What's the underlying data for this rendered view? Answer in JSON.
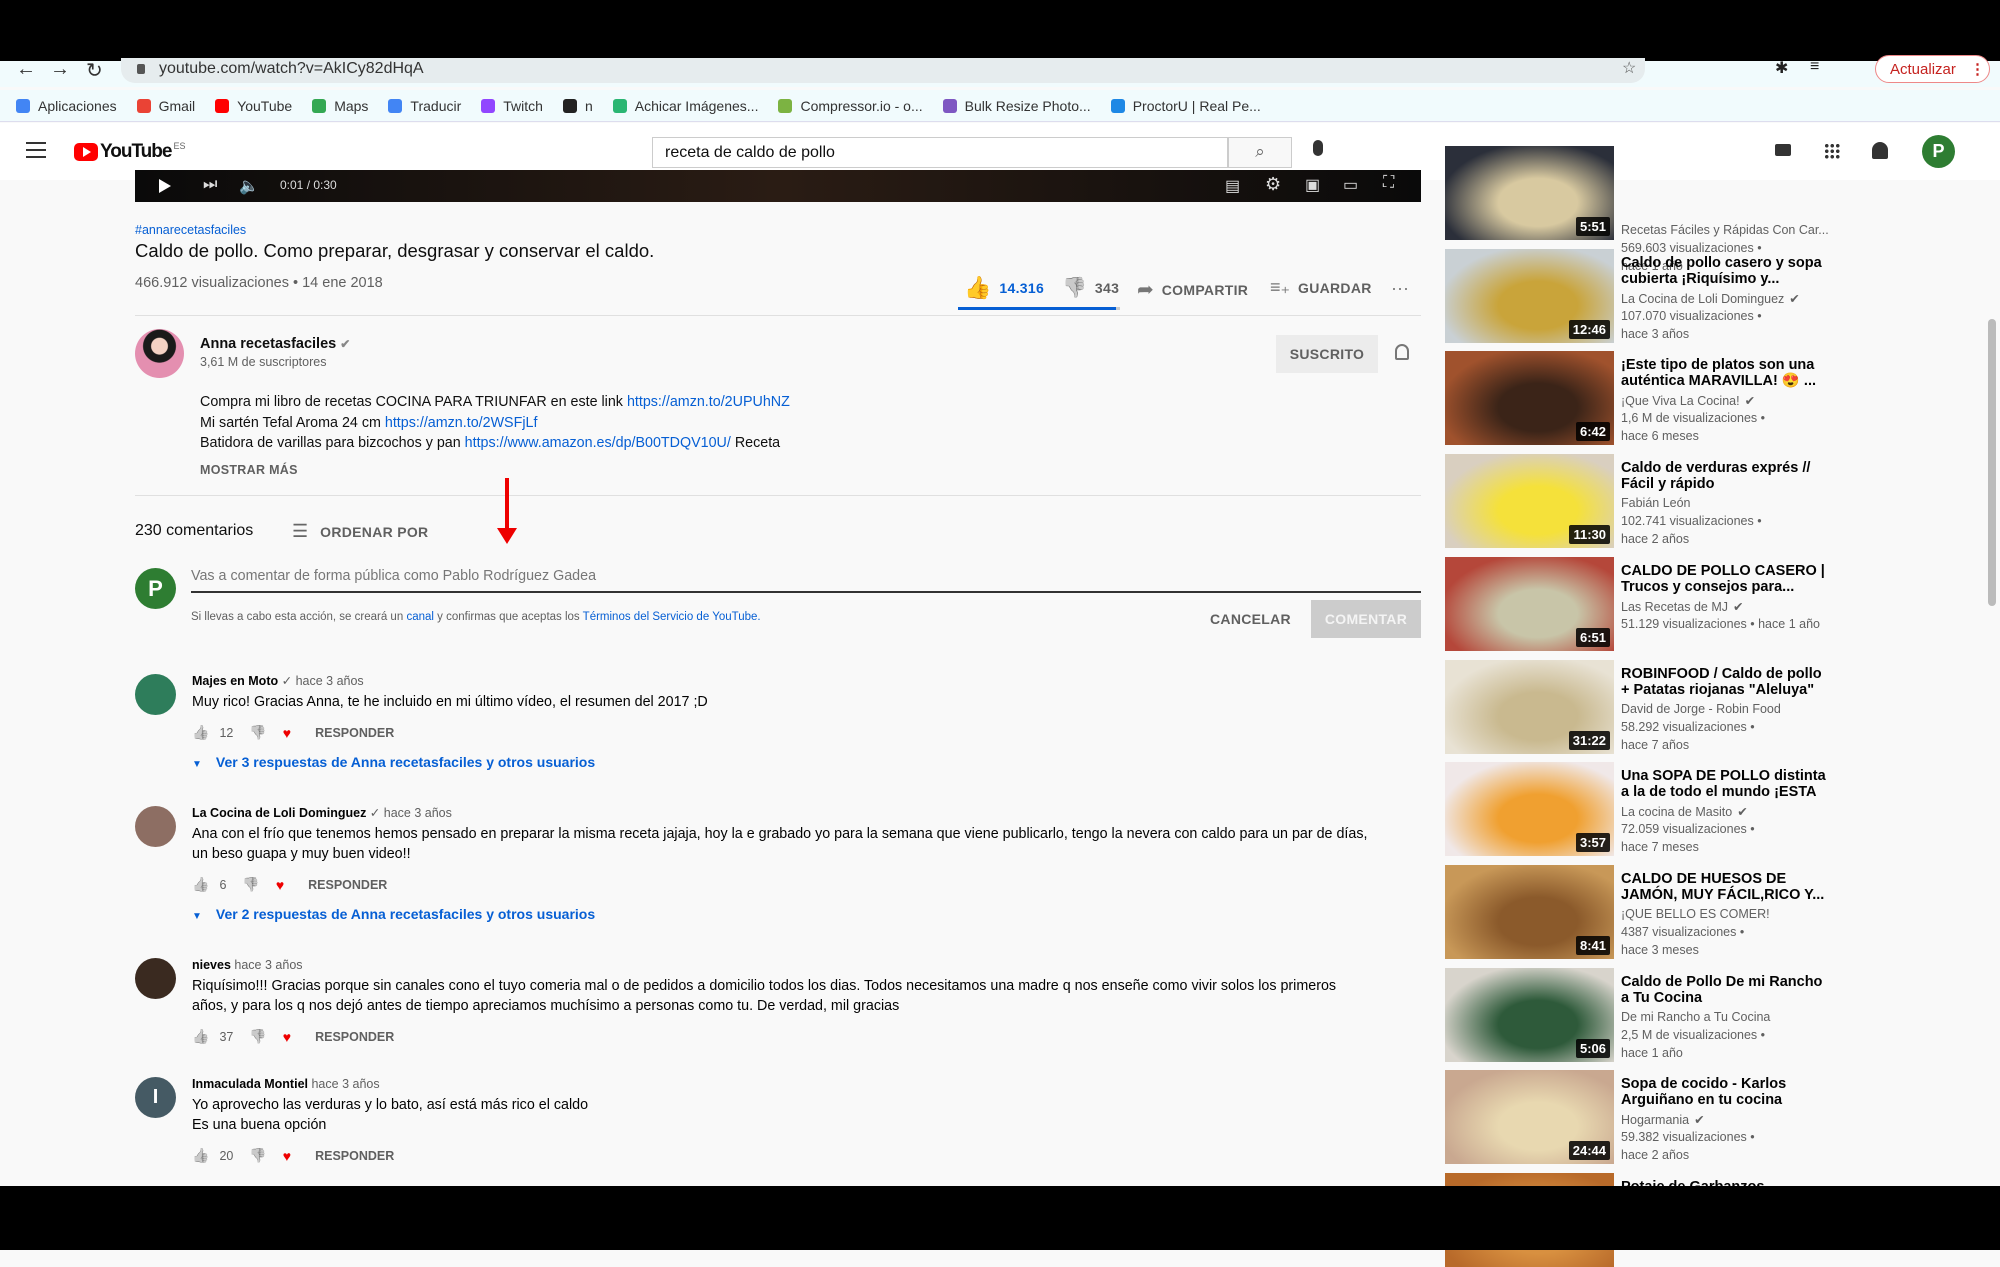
{
  "browser": {
    "url": "youtube.com/watch?v=AkICy82dHqA",
    "update_label": "Actualizar",
    "bookmarks": [
      {
        "label": "Aplicaciones",
        "color": "#4285f4"
      },
      {
        "label": "Gmail",
        "color": "#ea4335"
      },
      {
        "label": "YouTube",
        "color": "#ff0000"
      },
      {
        "label": "Maps",
        "color": "#34a853"
      },
      {
        "label": "Traducir",
        "color": "#4285f4"
      },
      {
        "label": "Twitch",
        "color": "#9146ff"
      },
      {
        "label": "n",
        "color": "#222"
      },
      {
        "label": "Achicar Imágenes...",
        "color": "#2bb673"
      },
      {
        "label": "Compressor.io - o...",
        "color": "#7cb342"
      },
      {
        "label": "Bulk Resize Photo...",
        "color": "#7e57c2"
      },
      {
        "label": "ProctorU | Real Pe...",
        "color": "#1e88e5"
      }
    ]
  },
  "header": {
    "logo": "YouTube",
    "region": "ES",
    "search_value": "receta de caldo de pollo",
    "avatar_letter": "P",
    "accent": "#ff0000"
  },
  "player": {
    "time": "0:01 / 0:30"
  },
  "video": {
    "hashtag": "#annarecetasfaciles",
    "title": "Caldo de pollo. Como preparar, desgrasar y conservar el caldo.",
    "views_date": "466.912 visualizaciones • 14 ene 2018",
    "likes": "14.316",
    "dislikes": "343",
    "share": "COMPARTIR",
    "save": "GUARDAR",
    "like_fraction": 0.977
  },
  "channel": {
    "name": "Anna recetasfaciles",
    "subs": "3,61 M de suscriptores",
    "subscribed": "SUSCRITO",
    "desc": [
      {
        "text": "Compra mi libro de recetas COCINA PARA TRIUNFAR en este link ",
        "link": "https://amzn.to/2UPUhNZ",
        "after": ""
      },
      {
        "text": "Mi sartén Tefal Aroma 24 cm ",
        "link": "https://amzn.to/2WSFjLf",
        "after": ""
      },
      {
        "text": "Batidora de varillas para bizcochos y pan  ",
        "link": "https://www.amazon.es/dp/B00TDQV10U/",
        "after": " Receta"
      }
    ],
    "show_more": "MOSTRAR MÁS"
  },
  "comments_header": {
    "count": "230 comentarios",
    "sort": "ORDENAR POR"
  },
  "composer": {
    "placeholder": "Vas a comentar de forma pública como Pablo Rodríguez Gadea",
    "notice_pre": "Si llevas a cabo esta acción, se creará un ",
    "notice_link1": "canal",
    "notice_mid": " y confirmas que aceptas los ",
    "notice_link2": "Términos del Servicio de YouTube.",
    "cancel": "CANCELAR",
    "submit": "COMENTAR",
    "avatar_letter": "P"
  },
  "reply_label": "RESPONDER",
  "comments": [
    {
      "author": "Majes en Moto",
      "verified": true,
      "age": "hace 3 años",
      "text": [
        "Muy rico! Gracias Anna, te he incluido en mi último vídeo, el resumen del 2017 ;D"
      ],
      "likes": "12",
      "replies": "Ver 3 respuestas de Anna recetasfaciles y otros usuarios",
      "avatar_color": "#2e7d5b",
      "avatar_letter": ""
    },
    {
      "author": "La Cocina de Loli Dominguez",
      "verified": true,
      "age": "hace 3 años",
      "text": [
        "Ana con el frío que tenemos hemos pensado en  preparar la misma receta jajaja, hoy la e grabado yo para la semana que viene publicarlo,  tengo la nevera con caldo para un par de días,",
        "un beso guapa y muy buen video!!"
      ],
      "likes": "6",
      "replies": "Ver 2 respuestas de Anna recetasfaciles y otros usuarios",
      "avatar_color": "#8d6e63",
      "avatar_letter": ""
    },
    {
      "author": "nieves",
      "verified": false,
      "age": "hace 3 años",
      "text": [
        "Riquísimo!!! Gracias porque sin canales cono el tuyo comeria mal o de pedidos a domicilio todos los dias. Todos necesitamos una madre q nos enseñe como vivir solos los primeros",
        "años, y para los q nos dejó antes de tiempo apreciamos muchísimo a personas como tu. De verdad, mil gracias"
      ],
      "likes": "37",
      "replies": "",
      "avatar_color": "#3a2a20",
      "avatar_letter": ""
    },
    {
      "author": "Inmaculada Montiel",
      "verified": false,
      "age": "hace 3 años",
      "text": [
        "Yo aprovecho las verduras y lo bato, así está más rico el caldo",
        "Es una buena opción"
      ],
      "likes": "20",
      "replies": "",
      "avatar_color": "#455a64",
      "avatar_letter": "I"
    }
  ],
  "sidebar": [
    {
      "title": "",
      "channel": "Recetas Fáciles y Rápidas Con Car...",
      "verified": false,
      "views": "569.603 visualizaciones",
      "age": "hace 1 año",
      "duration": "5:51",
      "colors": [
        "#2b2f3a",
        "#d8c9a0"
      ]
    },
    {
      "title": "Caldo de pollo casero y sopa cubierta ¡Riquísimo y...",
      "channel": "La Cocina de Loli Dominguez",
      "verified": true,
      "views": "107.070 visualizaciones",
      "age": "hace 3 años",
      "duration": "12:46",
      "colors": [
        "#c9d0d4",
        "#c9a43a"
      ]
    },
    {
      "title": "¡Este tipo de platos son una auténtica MARAVILLA! 😍 ...",
      "channel": "¡Que Viva La Cocina!",
      "verified": true,
      "views": "1,6 M de visualizaciones",
      "age": "hace 6 meses",
      "duration": "6:42",
      "colors": [
        "#a0522d",
        "#3b2418"
      ]
    },
    {
      "title": "Caldo de verduras exprés // Fácil y rápido",
      "channel": "Fabián León",
      "verified": false,
      "views": "102.741 visualizaciones",
      "age": "hace 2 años",
      "duration": "11:30",
      "colors": [
        "#d9cfc0",
        "#f5e13a"
      ]
    },
    {
      "title": "CALDO DE POLLO CASERO | Trucos y consejos para...",
      "channel": "Las Recetas de MJ",
      "verified": true,
      "views": "51.129 visualizaciones",
      "age": "hace 1 año",
      "inline_meta": true,
      "duration": "6:51",
      "colors": [
        "#b5473a",
        "#c8c5a8"
      ]
    },
    {
      "title": "ROBINFOOD / Caldo de pollo + Patatas riojanas \"Aleluya\"",
      "channel": "David de Jorge - Robin Food",
      "verified": false,
      "views": "58.292 visualizaciones",
      "age": "hace 7 años",
      "duration": "31:22",
      "colors": [
        "#e8e2d4",
        "#c9b98f"
      ]
    },
    {
      "title": "Una SOPA DE POLLO distinta a la de todo el mundo ¡ESTA DE...",
      "channel": "La cocina de Masito",
      "verified": true,
      "views": "72.059 visualizaciones",
      "age": "hace 7 meses",
      "duration": "3:57",
      "colors": [
        "#f0e8e8",
        "#f0a030"
      ]
    },
    {
      "title": "CALDO DE HUESOS DE JAMÓN, MUY FÁCIL,RICO Y...",
      "channel": "¡QUE BELLO ES COMER!",
      "verified": false,
      "views": "4387 visualizaciones",
      "age": "hace 3 meses",
      "duration": "8:41",
      "colors": [
        "#c89858",
        "#8b5a2b"
      ]
    },
    {
      "title": "Caldo de Pollo De mi Rancho a Tu Cocina",
      "channel": "De mi Rancho a Tu Cocina",
      "verified": false,
      "views": "2,5 M de visualizaciones",
      "age": "hace 1 año",
      "duration": "5:06",
      "colors": [
        "#d8d4cc",
        "#2e5a3a"
      ]
    },
    {
      "title": "Sopa de cocido - Karlos Arguiñano en tu cocina",
      "channel": "Hogarmania",
      "verified": true,
      "views": "59.382 visualizaciones",
      "age": "hace 2 años",
      "duration": "24:44",
      "colors": [
        "#c9a890",
        "#e8d8b0"
      ]
    },
    {
      "title": "Potaje de Garbanzos -",
      "channel": "",
      "verified": false,
      "views": "",
      "age": "",
      "duration": "",
      "colors": [
        "#b86a2a",
        "#d89040"
      ]
    }
  ]
}
